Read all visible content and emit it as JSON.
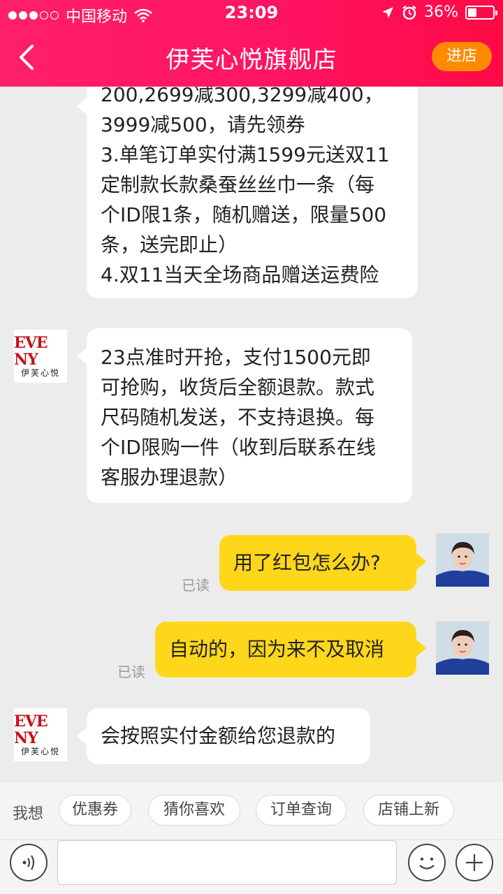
{
  "status_bar": {
    "carrier": "中国移动",
    "time": "23:09",
    "battery_percent": "36%",
    "battery_level": 0.36
  },
  "nav": {
    "title": "伊芙心悦旗舰店",
    "enter_store_label": "进店"
  },
  "messages": [
    {
      "from": "store",
      "lines": [
        "200,2699减300,3299减400，",
        "3999减500，请先领券",
        "3.单笔订单实付满1599元送双11",
        "定制款长款桑蚕丝丝巾一条（每",
        "个ID限1条，随机赠送，限量500",
        "条，送完即止）",
        "4.双11当天全场商品赠送运费险"
      ]
    },
    {
      "from": "store",
      "lines": [
        "23点准时开抢，支付1500元即",
        "可抢购，收货后全额退款。款式",
        "尺码随机发送，不支持退换。每",
        "个ID限购一件（收到后联系在线",
        "客服办理退款）"
      ]
    },
    {
      "from": "user",
      "text": "用了红包怎么办?",
      "status": "已读"
    },
    {
      "from": "user",
      "text": "自动的，因为来不及取消",
      "status": "已读"
    },
    {
      "from": "store",
      "text": "会按照实付金额给您退款的"
    }
  ],
  "store_logo": {
    "top": "EVE NY",
    "bottom": "伊芙心悦"
  },
  "quick_replies": {
    "label": "我想",
    "chips": [
      "优惠券",
      "猜你喜欢",
      "订单查询",
      "店铺上新"
    ]
  },
  "colors": {
    "header_pink": "#ff1464",
    "accent_orange": "#ff8a00",
    "user_bubble": "#ffd71a"
  },
  "icons": [
    "back-arrow-icon",
    "voice-icon",
    "emoji-icon",
    "plus-icon",
    "wifi-icon",
    "location-icon",
    "alarm-icon",
    "battery-icon"
  ]
}
